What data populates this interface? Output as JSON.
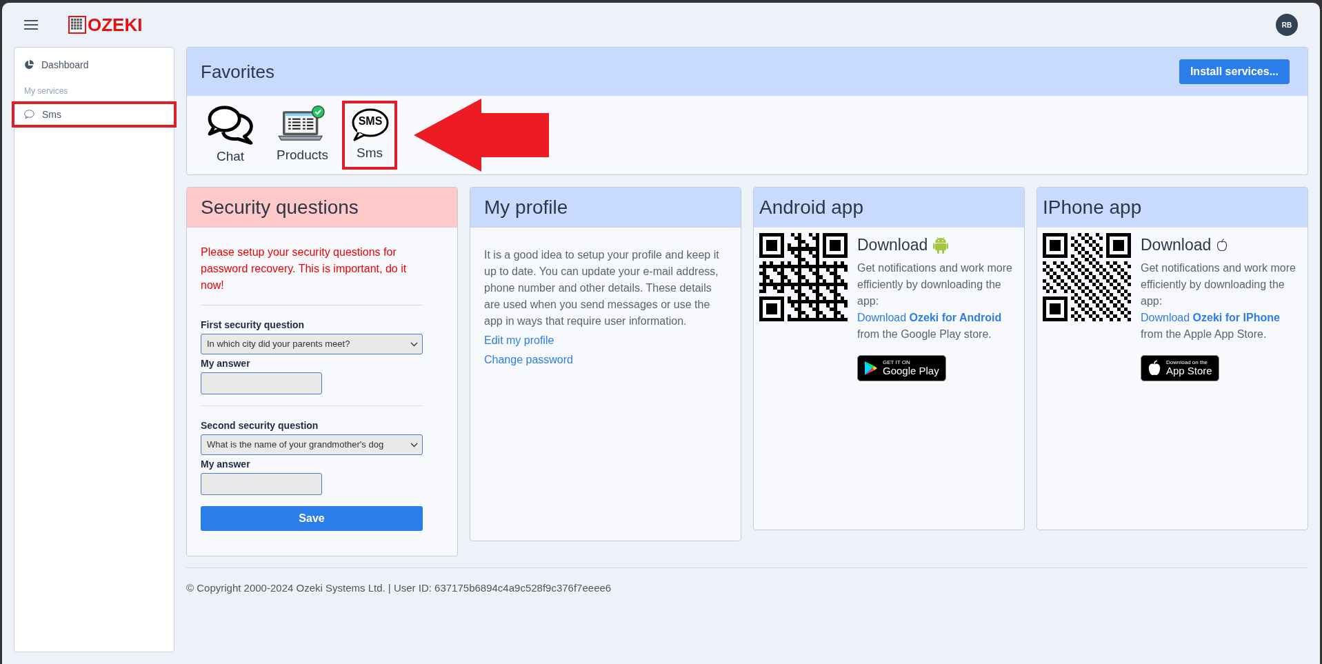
{
  "header": {
    "brand": "OZEKI",
    "avatar": "RB"
  },
  "sidebar": {
    "items": [
      {
        "kind": "dashboard",
        "label": "Dashboard",
        "highlighted": false
      },
      {
        "kind": "section",
        "label": "My services"
      },
      {
        "kind": "service",
        "label": "Sms",
        "highlighted": true
      }
    ]
  },
  "favorites": {
    "title": "Favorites",
    "button": "Install services...",
    "annotation_arrow": true,
    "items": [
      {
        "kind": "chat",
        "label": "Chat",
        "highlighted": false
      },
      {
        "kind": "products",
        "label": "Products",
        "highlighted": false
      },
      {
        "kind": "sms",
        "icon_text": "SMS",
        "label": "Sms",
        "highlighted": true
      }
    ]
  },
  "security": {
    "title": "Security questions",
    "warning": "Please setup your security questions for password recovery. This is important, do it now!",
    "questions": [
      {
        "label": "First security question",
        "value": "In which city did your parents meet?",
        "answer_label": "My answer"
      },
      {
        "label": "Second security question",
        "value": "What is the name of your grandmother's dog",
        "answer_label": "My answer"
      }
    ],
    "button": "Save"
  },
  "profile": {
    "title": "My profile",
    "text": "It is a good idea to setup your profile and keep it up to date. You can update your e-mail address, phone number and other details. These details are used when you send messages or use the app in ways that require user information.",
    "links": [
      "Edit my profile",
      "Change password"
    ]
  },
  "apps": [
    {
      "kind": "android",
      "title": "Android app",
      "heading": "Download",
      "text": "Get notifications and work more efficiently by downloading the app:",
      "link": "Download **Ozeki for Android**",
      "suffix": "from the Google Play store.",
      "badge_small": "GET IT ON",
      "badge_big": "Google Play"
    },
    {
      "kind": "ios",
      "title": "IPhone app",
      "heading": "Download",
      "text": "Get notifications and work more efficiently by downloading the app:",
      "link": "Download **Ozeki for IPhone**",
      "suffix": "from the Apple App Store.",
      "badge_small": "Download on the",
      "badge_big": "App Store"
    }
  ],
  "footer": "© Copyright 2000-2024 Ozeki Systems Ltd. | User ID: 637175b6894c4a9c528f9c376f7eeee6"
}
